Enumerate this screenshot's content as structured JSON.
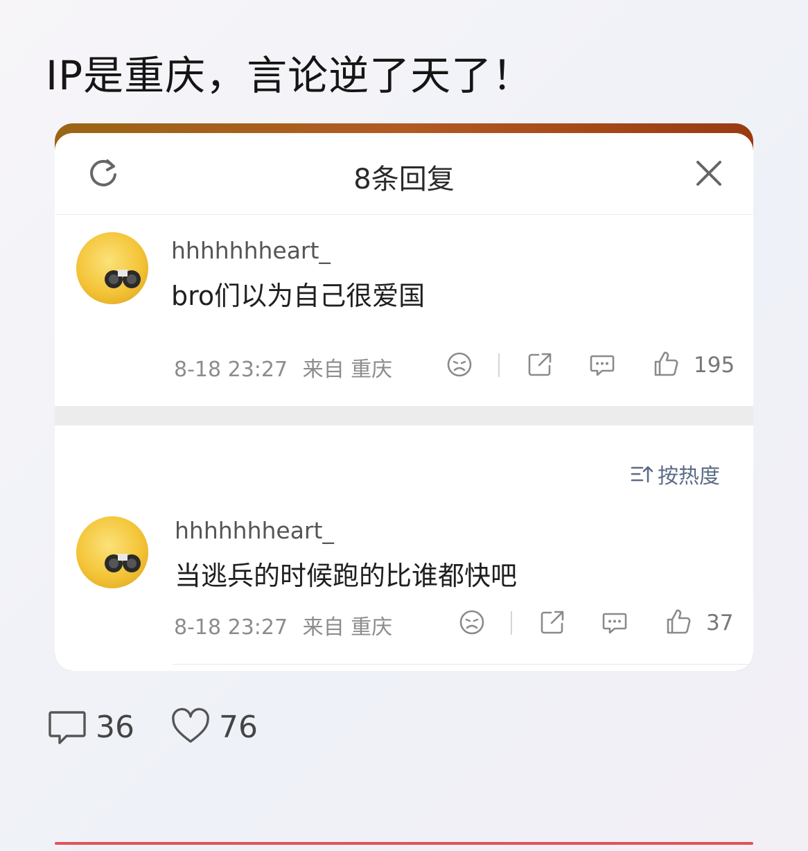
{
  "post": {
    "title": "IP是重庆，言论逆了天了！",
    "comment_count": "36",
    "like_count": "76"
  },
  "sheet": {
    "title": "8条回复",
    "sort_label": "按热度"
  },
  "comments": [
    {
      "username": "hhhhhhheart_",
      "text": "bro们以为自己很爱国",
      "time": "8-18 23:27",
      "location": "来自 重庆",
      "likes": "195"
    },
    {
      "username": "hhhhhhheart_",
      "text": "当逃兵的时候跑的比谁都快吧",
      "time": "8-18 23:27",
      "location": "来自 重庆",
      "likes": "37"
    }
  ],
  "colors": {
    "accent_red": "#e25257",
    "header_gradient_start": "#9a6516",
    "header_gradient_end": "#9a3a10",
    "sort_text": "#5b6b85"
  },
  "icons": [
    "refresh-icon",
    "close-icon",
    "dislike-face-icon",
    "share-icon",
    "comment-icon",
    "thumbs-up-icon",
    "sort-icon",
    "heart-icon"
  ]
}
